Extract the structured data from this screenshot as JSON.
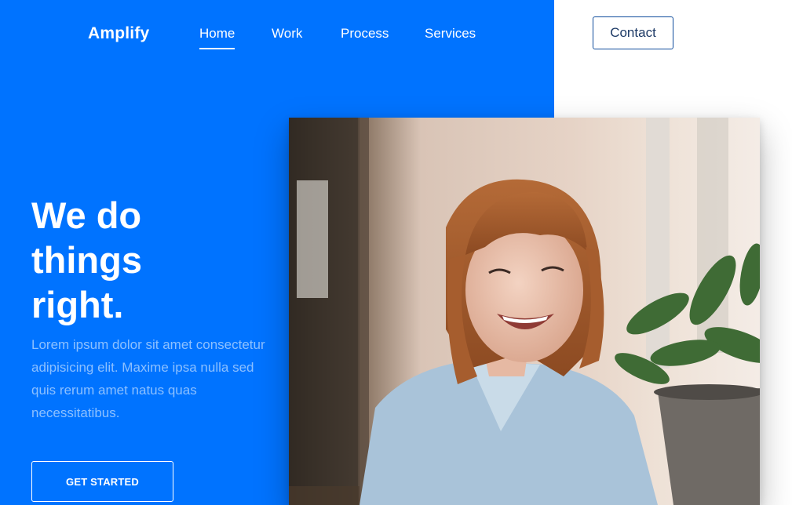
{
  "brand": {
    "name": "Amplify",
    "accent_color": "#0073ff"
  },
  "nav": {
    "items": [
      {
        "label": "Home",
        "active": true
      },
      {
        "label": "Work",
        "active": false
      },
      {
        "label": "Process",
        "active": false
      },
      {
        "label": "Services",
        "active": false
      }
    ],
    "contact_label": "Contact"
  },
  "hero": {
    "headline_lines": [
      "We do",
      "things",
      "right."
    ],
    "lead": "Lorem ipsum dolor sit amet consectetur adipisicing elit. Maxime ipsa nulla sed quis rerum amet natus quas necessitatibus.",
    "cta_label": "GET STARTED"
  }
}
